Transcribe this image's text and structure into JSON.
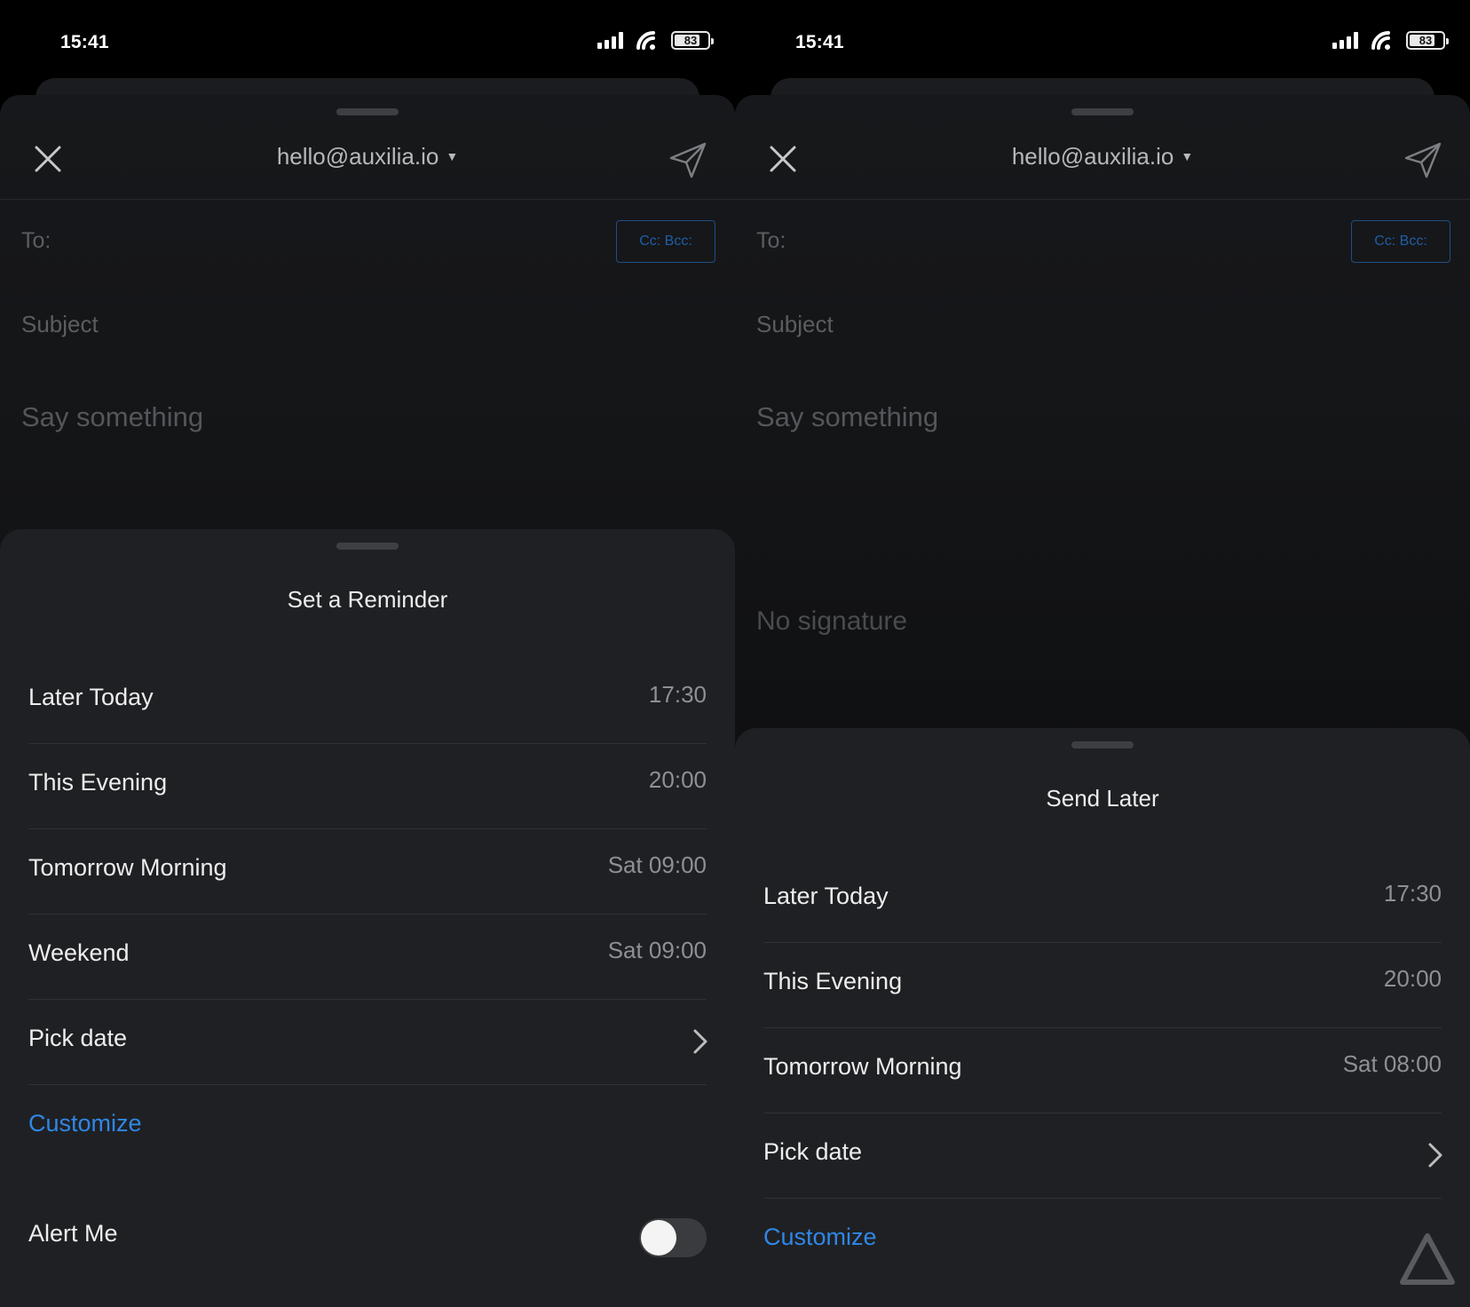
{
  "left": {
    "status": {
      "time": "15:41",
      "battery": "83"
    },
    "composer": {
      "from": "hello@auxilia.io",
      "to_label": "To:",
      "cc_bcc": "Cc: Bcc:",
      "subject_placeholder": "Subject",
      "body_placeholder": "Say something"
    },
    "sheet": {
      "title": "Set a Reminder",
      "options": [
        {
          "label": "Later Today",
          "value": "17:30"
        },
        {
          "label": "This Evening",
          "value": "20:00"
        },
        {
          "label": "Tomorrow Morning",
          "value": "Sat 09:00"
        },
        {
          "label": "Weekend",
          "value": "Sat 09:00"
        }
      ],
      "pick_date": "Pick date",
      "customize": "Customize",
      "alert_me": "Alert Me",
      "alert_me_on": false
    }
  },
  "right": {
    "status": {
      "time": "15:41",
      "battery": "83"
    },
    "composer": {
      "from": "hello@auxilia.io",
      "to_label": "To:",
      "cc_bcc": "Cc: Bcc:",
      "subject_placeholder": "Subject",
      "body_placeholder": "Say something",
      "signature": "No signature"
    },
    "sheet": {
      "title": "Send Later",
      "options": [
        {
          "label": "Later Today",
          "value": "17:30"
        },
        {
          "label": "This Evening",
          "value": "20:00"
        },
        {
          "label": "Tomorrow Morning",
          "value": "Sat 08:00"
        }
      ],
      "pick_date": "Pick date",
      "customize": "Customize"
    }
  },
  "colors": {
    "accent": "#2f87e6",
    "sheet_bg": "#1f2023",
    "composer_bg": "#141517"
  }
}
